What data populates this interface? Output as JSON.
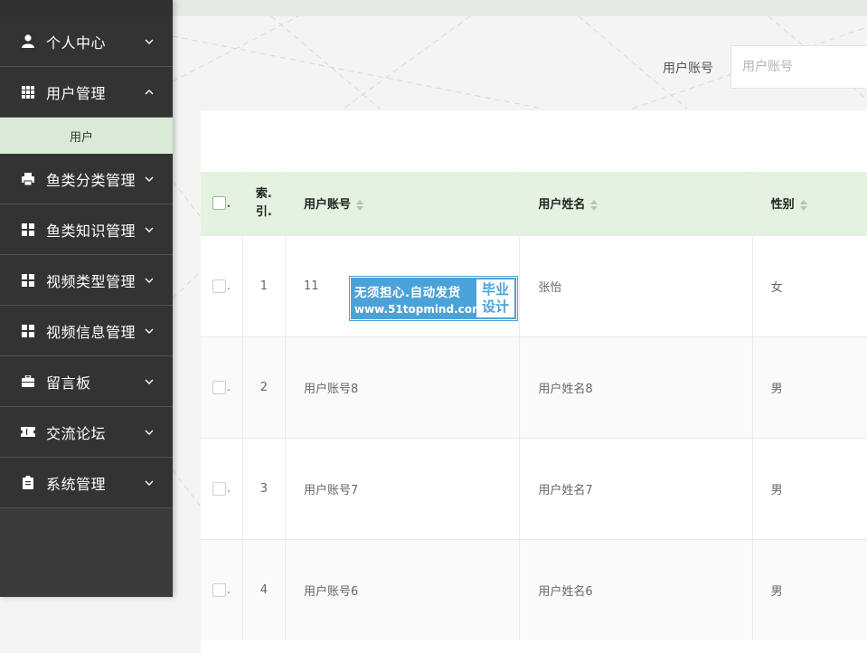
{
  "sidebar": {
    "items": [
      {
        "label": "个人中心",
        "icon": "user-icon",
        "expanded": false
      },
      {
        "label": "用户管理",
        "icon": "grid-icon",
        "expanded": true,
        "children": [
          {
            "label": "用户"
          }
        ]
      },
      {
        "label": "鱼类分类管理",
        "icon": "printer-icon",
        "expanded": false
      },
      {
        "label": "鱼类知识管理",
        "icon": "apps-icon",
        "expanded": false
      },
      {
        "label": "视频类型管理",
        "icon": "apps-icon",
        "expanded": false
      },
      {
        "label": "视频信息管理",
        "icon": "apps-icon",
        "expanded": false
      },
      {
        "label": "留言板",
        "icon": "briefcase-icon",
        "expanded": false
      },
      {
        "label": "交流论坛",
        "icon": "ticket-icon",
        "expanded": false
      },
      {
        "label": "系统管理",
        "icon": "clipboard-icon",
        "expanded": false
      }
    ]
  },
  "search": {
    "label": "用户账号",
    "placeholder": "用户账号",
    "value": ""
  },
  "table": {
    "headers": {
      "index_line1": "索.",
      "index_line2": "引.",
      "account": "用户账号",
      "name": "用户姓名",
      "sex": "性别"
    },
    "rows": [
      {
        "index": "1",
        "account": "11",
        "name": "张怡",
        "sex": "女"
      },
      {
        "index": "2",
        "account": "用户账号8",
        "name": "用户姓名8",
        "sex": "男"
      },
      {
        "index": "3",
        "account": "用户账号7",
        "name": "用户姓名7",
        "sex": "男"
      },
      {
        "index": "4",
        "account": "用户账号6",
        "name": "用户姓名6",
        "sex": "男"
      }
    ]
  },
  "watermark": {
    "line1": "无须担心.自动发货",
    "line2": "www.51topmind.com",
    "badge1": "毕业",
    "badge2": "设计"
  },
  "colors": {
    "sidebar_bg": "#333333",
    "submenu_bg": "#d9ead6",
    "header_bg": "#e3f3df",
    "watermark_bg": "#4aa3d8"
  }
}
